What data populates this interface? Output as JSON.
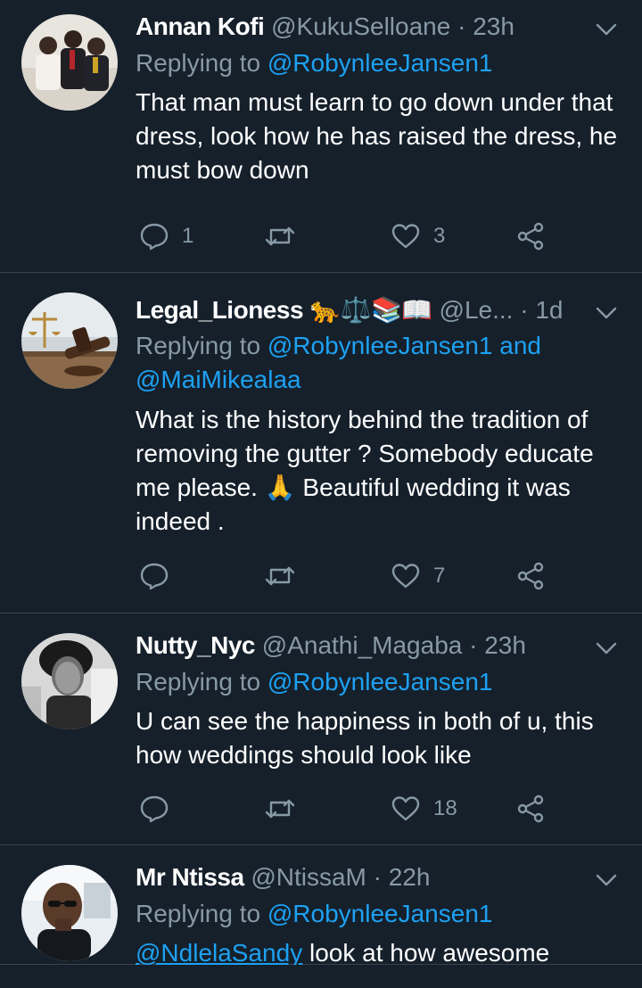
{
  "colors": {
    "background": "#15202b",
    "divider": "#38444d",
    "secondary_text": "#8899a6",
    "link": "#1da1f2",
    "primary_text": "#ffffff"
  },
  "tweets": [
    {
      "display_name": "Annan Kofi",
      "handle": "@KukuSelloane",
      "separator": "·",
      "time": "23h",
      "replying_prefix": "Replying to",
      "replying_to": [
        "@RobynleeJansen1"
      ],
      "replying_joiner": "",
      "text": "That man must learn to go down under that dress, look how he has raised the dress, he must bow down",
      "reply_count": "1",
      "retweet_count": "",
      "like_count": "3"
    },
    {
      "display_name": "Legal_Lioness 🐆⚖️📚📖",
      "handle": "@Le...",
      "separator": "·",
      "time": "1d",
      "replying_prefix": "Replying to",
      "replying_to": [
        "@RobynleeJansen1",
        "@MaiMikealaa"
      ],
      "replying_joiner": "and",
      "text": "What is the history behind the tradition of removing the gutter ? Somebody educate me please. 🙏 Beautiful wedding it was indeed .",
      "reply_count": "",
      "retweet_count": "",
      "like_count": "7"
    },
    {
      "display_name": "Nutty_Nyc",
      "handle": "@Anathi_Magaba",
      "separator": "·",
      "time": "23h",
      "replying_prefix": "Replying to",
      "replying_to": [
        "@RobynleeJansen1"
      ],
      "replying_joiner": "",
      "text": "U can see the happiness in both of u, this how weddings should look like",
      "reply_count": "",
      "retweet_count": "",
      "like_count": "18"
    },
    {
      "display_name": "Mr Ntissa",
      "handle": "@NtissaM",
      "separator": "·",
      "time": "22h",
      "replying_prefix": "Replying to",
      "replying_to": [
        "@RobynleeJansen1"
      ],
      "replying_joiner": "",
      "text_mention": "@NdlelaSandy",
      "text": " look at how awesome"
    }
  ],
  "icons": {
    "reply": "reply-bubble-icon",
    "retweet": "retweet-icon",
    "like": "heart-icon",
    "share": "share-icon",
    "caret": "chevron-down-icon"
  }
}
